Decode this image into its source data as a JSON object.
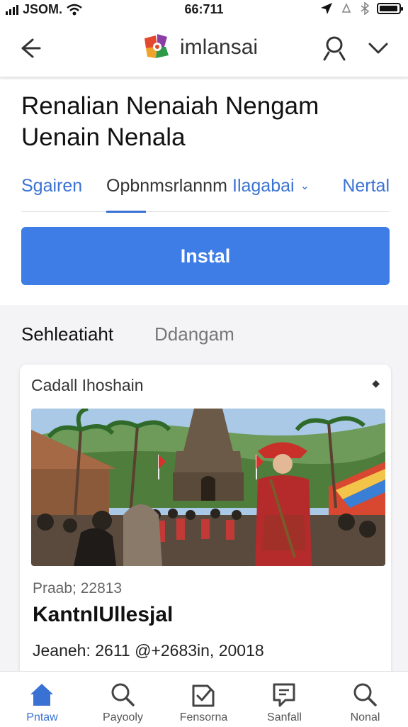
{
  "status_bar": {
    "carrier": "JSOM.",
    "time": "66:711"
  },
  "header": {
    "app_name": "imlansai"
  },
  "details": {
    "title": "Renalian Nenaiah Nengam Uenain Nenala",
    "tabs": [
      {
        "label": "Sgairen"
      },
      {
        "label": "Opbnmsrlannm"
      },
      {
        "label": "Ilagabai"
      },
      {
        "label": "Nertal"
      }
    ],
    "install_label": "Instal"
  },
  "section": {
    "active_tab": "Sehleatiaht",
    "other_tab": "Ddangam"
  },
  "card": {
    "header": "Cadall Ihoshain",
    "more_glyph": "◆",
    "meta": "Praab; 22813",
    "title": "KantnlUllesjal",
    "footer": "Jeaneh: 2611 @+2683in, 20018"
  },
  "bottom_nav": [
    {
      "label": "Pntaw",
      "icon": "home-icon",
      "active": true
    },
    {
      "label": "Payooly",
      "icon": "search-icon",
      "active": false
    },
    {
      "label": "Fensorna",
      "icon": "badge-check-icon",
      "active": false
    },
    {
      "label": "Sanfall",
      "icon": "chat-icon",
      "active": false
    },
    {
      "label": "Nonal",
      "icon": "search-icon",
      "active": false
    }
  ],
  "colors": {
    "accent": "#3f7de6",
    "link": "#3a72d3",
    "background": "#f4f4f6"
  }
}
